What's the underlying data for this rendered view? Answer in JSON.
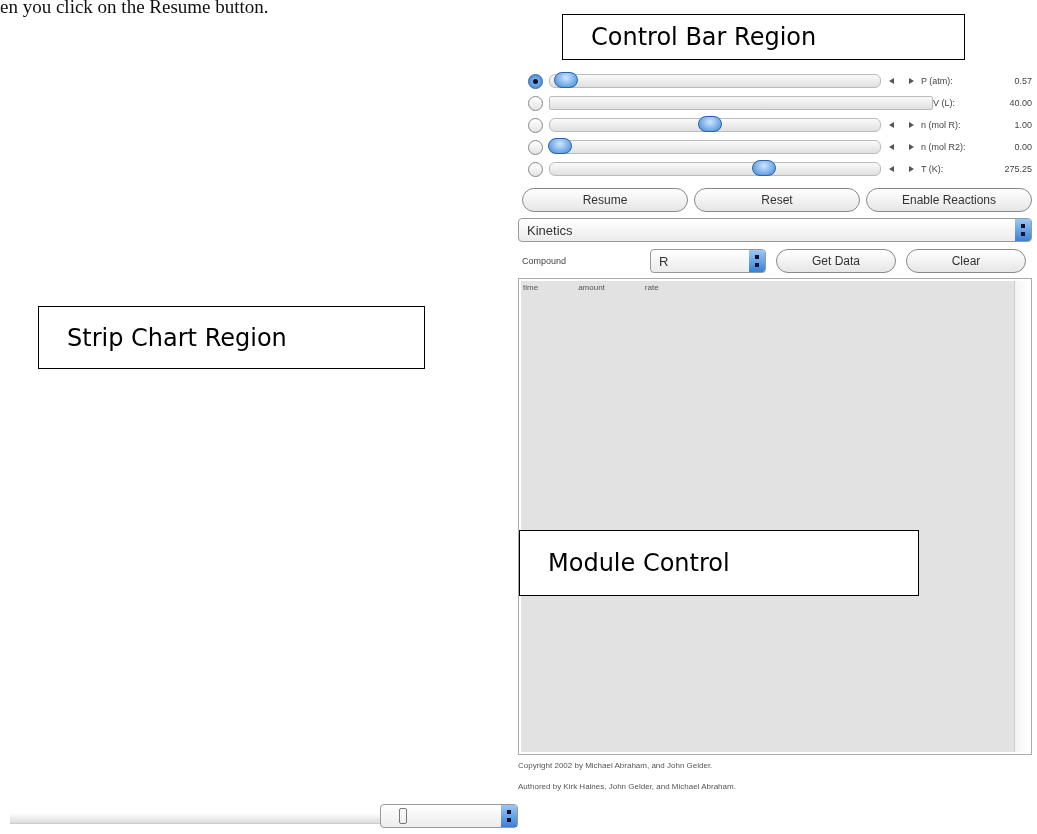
{
  "document_text": "en you click on the Resume button.",
  "annotations": [
    {
      "label": "Control Bar Region"
    },
    {
      "label": "Strip Chart Region"
    },
    {
      "label": "Module Control"
    }
  ],
  "controls": [
    {
      "kind": "slider",
      "selected": true,
      "level": 0.02,
      "label": "P (atm):",
      "value": "0.57"
    },
    {
      "kind": "bar",
      "selected": false,
      "label": "V (L):",
      "value": "40.00"
    },
    {
      "kind": "slider",
      "selected": false,
      "level": 0.5,
      "label": "n (mol R):",
      "value": "1.00"
    },
    {
      "kind": "slider",
      "selected": false,
      "level": 0.0,
      "label": "n (mol R2):",
      "value": "0.00"
    },
    {
      "kind": "slider",
      "selected": false,
      "level": 0.68,
      "label": "T (K):",
      "value": "275.25"
    }
  ],
  "buttons": [
    "Resume",
    "Reset",
    "Enable Reactions"
  ],
  "module_select": "Kinetics",
  "compound": {
    "label": "Compound",
    "value": "R",
    "buttons": [
      "Get Data",
      "Clear"
    ]
  },
  "table": {
    "columns": [
      "time",
      "amount",
      "rate"
    ]
  },
  "footer": [
    "Copyright 2002 by Michael Abraham, and John Gelder.",
    "Authored by Kirk Haines, John Gelder, and Michael Abraham."
  ]
}
